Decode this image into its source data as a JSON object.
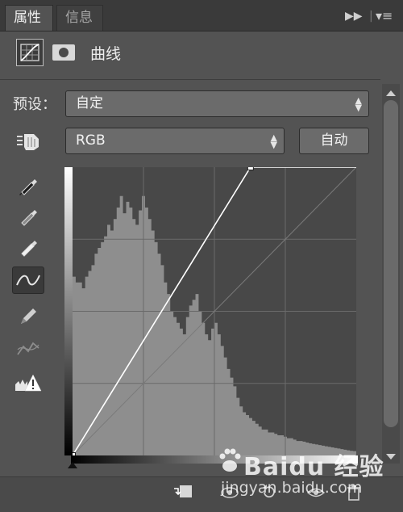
{
  "tabs": [
    {
      "label": "属性",
      "active": true
    },
    {
      "label": "信息",
      "active": false
    }
  ],
  "panel": {
    "title": "曲线",
    "icons": [
      "curves-adjustment-icon",
      "layer-mask-icon"
    ]
  },
  "preset": {
    "label": "预设：",
    "value": "自定"
  },
  "channel": {
    "value": "RGB"
  },
  "auto_button": {
    "label": "自动"
  },
  "tools": [
    "on-image-adjust-hand-icon",
    "black-point-eyedropper-icon",
    "gray-point-eyedropper-icon",
    "white-point-eyedropper-icon",
    "curve-point-edit-icon",
    "pencil-draw-icon",
    "smooth-curve-icon",
    "clipping-warning-icon"
  ],
  "curve": {
    "points": [
      [
        0,
        0
      ],
      [
        160,
        255
      ],
      [
        255,
        255
      ]
    ],
    "grid_divisions": 4,
    "histogram": [
      0.62,
      0.6,
      0.6,
      0.58,
      0.62,
      0.64,
      0.66,
      0.7,
      0.72,
      0.74,
      0.76,
      0.8,
      0.78,
      0.82,
      0.86,
      0.9,
      0.84,
      0.88,
      0.86,
      0.82,
      0.8,
      0.85,
      0.9,
      0.86,
      0.82,
      0.78,
      0.74,
      0.7,
      0.66,
      0.6,
      0.56,
      0.5,
      0.48,
      0.46,
      0.44,
      0.42,
      0.48,
      0.52,
      0.54,
      0.56,
      0.5,
      0.46,
      0.42,
      0.4,
      0.44,
      0.46,
      0.42,
      0.38,
      0.34,
      0.3,
      0.27,
      0.24,
      0.2,
      0.17,
      0.15,
      0.14,
      0.13,
      0.12,
      0.11,
      0.1,
      0.09,
      0.09,
      0.08,
      0.08,
      0.075,
      0.07,
      0.07,
      0.065,
      0.06,
      0.06,
      0.055,
      0.05,
      0.05,
      0.048,
      0.045,
      0.042,
      0.04,
      0.038,
      0.036,
      0.034,
      0.032,
      0.03,
      0.028,
      0.026,
      0.024,
      0.022,
      0.02,
      0.018,
      0.016,
      0.015
    ]
  },
  "bottom_icons": [
    "clip-to-layer-icon",
    "view-previous-state-icon",
    "reset-icon",
    "toggle-visibility-icon",
    "delete-icon"
  ],
  "watermark": {
    "brand": "Baidu 经验",
    "url": "jingyan.baidu.com"
  },
  "colors": {
    "panel_bg": "#535353",
    "graph_bg": "#484848",
    "histogram": "#8e8e8e",
    "curve": "#ffffff"
  }
}
